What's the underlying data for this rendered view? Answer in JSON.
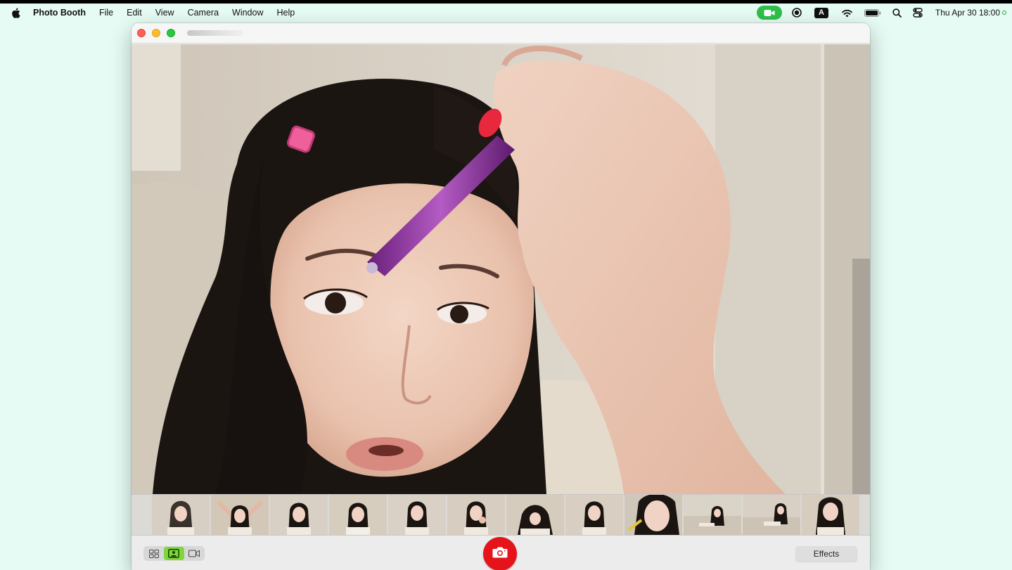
{
  "menubar": {
    "app_name": "Photo Booth",
    "items": [
      "File",
      "Edit",
      "View",
      "Camera",
      "Window",
      "Help"
    ],
    "clock": "Thu Apr 30  18:00",
    "input_badge": "A"
  },
  "window": {
    "title": ""
  },
  "filmstrip": {
    "thumbnail_count": 12
  },
  "toolbar": {
    "effects_label": "Effects",
    "view_modes": [
      "grid-view",
      "single-photo",
      "video"
    ],
    "active_mode": "single-photo"
  },
  "colors": {
    "desktop": "#e6fbf4",
    "shutter": "#e5141b",
    "active_segment": "#7ed83a",
    "camera_indicator": "#2fbf4a"
  }
}
